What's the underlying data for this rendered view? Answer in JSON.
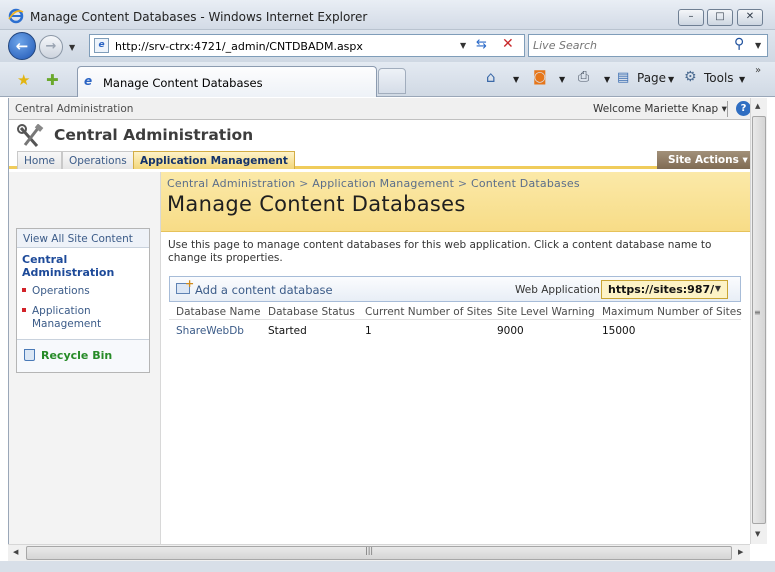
{
  "window": {
    "title": "Manage Content Databases - Windows Internet Explorer",
    "min_glyph": "–",
    "max_glyph": "□",
    "close_glyph": "✕"
  },
  "navbar": {
    "url": "http://srv-ctrx:4721/_admin/CNTDBADM.aspx",
    "search_placeholder": "Live Search"
  },
  "tabbar": {
    "active_tab": "Manage Content Databases",
    "page_label": "Page",
    "tools_label": "Tools"
  },
  "global": {
    "breadcrumb": "Central Administration",
    "welcome": "Welcome Mariette Knap ▾",
    "help_glyph": "?"
  },
  "site": {
    "title": "Central Administration"
  },
  "topnav": {
    "tabs": [
      {
        "label": "Home"
      },
      {
        "label": "Operations"
      },
      {
        "label": "Application Management"
      }
    ],
    "site_actions": "Site Actions ▾"
  },
  "quicklaunch": {
    "view_all": "View All Site Content",
    "heading": "Central Administration",
    "items": [
      {
        "label": "Operations"
      },
      {
        "label": "Application Management"
      }
    ],
    "recycle_bin": "Recycle Bin"
  },
  "pagetitle": {
    "crumbs": [
      "Central Administration",
      "Application Management",
      "Content Databases"
    ],
    "crumb_sep": ">",
    "title": "Manage Content Databases"
  },
  "content": {
    "description": "Use this page to manage content databases for this web application. Click a content database name to change its properties.",
    "add_link": "Add a content database",
    "web_app_label": "Web Application:",
    "web_app_value": "https://sites:987/"
  },
  "table": {
    "headers": [
      "Database Name",
      "Database Status",
      "Current Number of Sites",
      "Site Level Warning",
      "Maximum Number of Sites"
    ],
    "rows": [
      [
        "ShareWebDb",
        "Started",
        "1",
        "9000",
        "15000"
      ]
    ]
  },
  "colors": {
    "accent_gold": "#f0cc5b",
    "link_blue": "#3b5b88",
    "site_actions_bg": "#8f7c63",
    "recycle_green": "#268b27"
  }
}
